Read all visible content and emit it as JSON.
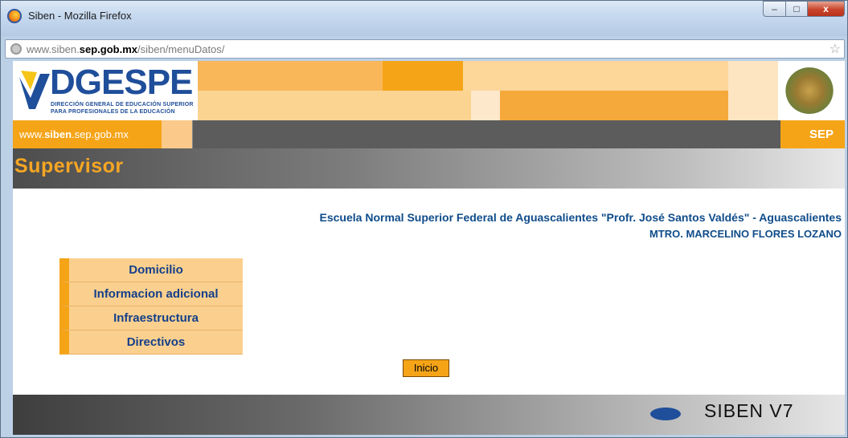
{
  "window": {
    "title": "Siben - Mozilla Firefox",
    "controls": {
      "minimize": "–",
      "maximize": "□",
      "close": "x"
    }
  },
  "address_bar": {
    "url_prefix": "www.siben.",
    "url_domain": "sep.gob.mx",
    "url_path": "/siben/menuDatos/"
  },
  "header": {
    "logo_text": "DGESPE",
    "logo_sub1": "DIRECCIÓN GENERAL DE EDUCACIÓN SUPERIOR",
    "logo_sub2": "PARA PROFESIONALES DE LA EDUCACIÓN",
    "site_link_prefix": "www.",
    "site_link_bold": "siben",
    "site_link_suffix": ".sep.gob.mx",
    "sep_badge": "SEP"
  },
  "page": {
    "title": "Supervisor",
    "school": "Escuela Normal Superior Federal de Aguascalientes \"Profr. José Santos Valdés\" - Aguascalientes",
    "person": "MTRO. MARCELINO FLORES LOZANO"
  },
  "menu": {
    "items": [
      {
        "label": "Domicilio"
      },
      {
        "label": "Informacion adicional"
      },
      {
        "label": "Infraestructura"
      },
      {
        "label": "Directivos"
      }
    ]
  },
  "actions": {
    "inicio_label": "Inicio"
  },
  "footer": {
    "brand": "SIBEN  V7"
  },
  "colors": {
    "accent_orange": "#f5a418",
    "link_blue": "#0f4c8a",
    "logo_blue": "#1f4e9a"
  }
}
